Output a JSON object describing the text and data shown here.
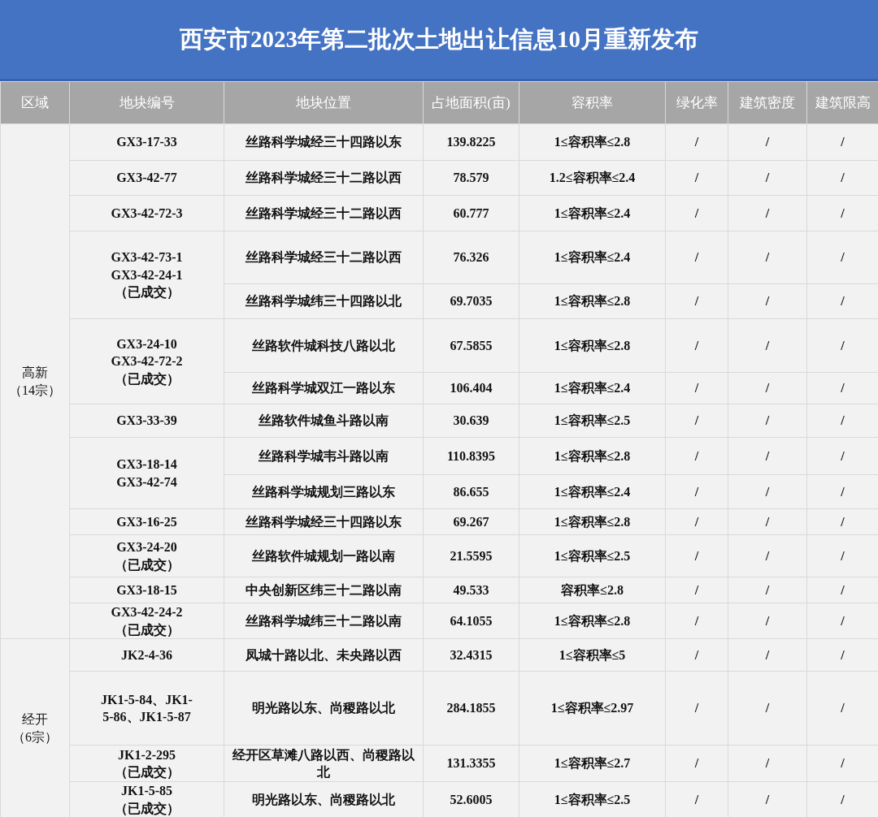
{
  "title": "西安市2023年第二批次土地出让信息10月重新发布",
  "table": {
    "columns": [
      "区域",
      "地块编号",
      "地块位置",
      "占地面积(亩)",
      "容积率",
      "绿化率",
      "建筑密度",
      "建筑限高"
    ],
    "regions": [
      {
        "name": "高新",
        "count": "（14宗）",
        "groups": [
          {
            "code": "GX3-17-33",
            "plots": [
              {
                "location": "丝路科学城经三十四路以东",
                "area": "139.8225",
                "far": "1≤容积率≤2.8",
                "green": "/",
                "density": "/",
                "height": "/"
              }
            ]
          },
          {
            "code": "GX3-42-77",
            "plots": [
              {
                "location": "丝路科学城经三十二路以西",
                "area": "78.579",
                "far": "1.2≤容积率≤2.4",
                "green": "/",
                "density": "/",
                "height": "/"
              }
            ]
          },
          {
            "code": "GX3-42-72-3",
            "plots": [
              {
                "location": "丝路科学城经三十二路以西",
                "area": "60.777",
                "far": "1≤容积率≤2.4",
                "green": "/",
                "density": "/",
                "height": "/"
              }
            ]
          },
          {
            "code": "GX3-42-73-1\nGX3-42-24-1\n（已成交）",
            "plots": [
              {
                "location": "丝路科学城经三十二路以西",
                "area": "76.326",
                "far": "1≤容积率≤2.4",
                "green": "/",
                "density": "/",
                "height": "/"
              },
              {
                "location": "丝路科学城纬三十四路以北",
                "area": "69.7035",
                "far": "1≤容积率≤2.8",
                "green": "/",
                "density": "/",
                "height": "/"
              }
            ]
          },
          {
            "code": "GX3-24-10\nGX3-42-72-2\n（已成交）",
            "plots": [
              {
                "location": "丝路软件城科技八路以北",
                "area": "67.5855",
                "far": "1≤容积率≤2.8",
                "green": "/",
                "density": "/",
                "height": "/"
              },
              {
                "location": "丝路科学城双江一路以东",
                "area": "106.404",
                "far": "1≤容积率≤2.4",
                "green": "/",
                "density": "/",
                "height": "/"
              }
            ]
          },
          {
            "code": "GX3-33-39",
            "plots": [
              {
                "location": "丝路软件城鱼斗路以南",
                "area": "30.639",
                "far": "1≤容积率≤2.5",
                "green": "/",
                "density": "/",
                "height": "/"
              }
            ]
          },
          {
            "code": "GX3-18-14\nGX3-42-74",
            "plots": [
              {
                "location": "丝路科学城韦斗路以南",
                "area": "110.8395",
                "far": "1≤容积率≤2.8",
                "green": "/",
                "density": "/",
                "height": "/"
              },
              {
                "location": "丝路科学城规划三路以东",
                "area": "86.655",
                "far": "1≤容积率≤2.4",
                "green": "/",
                "density": "/",
                "height": "/"
              }
            ]
          },
          {
            "code": "GX3-16-25",
            "plots": [
              {
                "location": "丝路科学城经三十四路以东",
                "area": "69.267",
                "far": "1≤容积率≤2.8",
                "green": "/",
                "density": "/",
                "height": "/"
              }
            ]
          },
          {
            "code": "GX3-24-20\n（已成交）",
            "plots": [
              {
                "location": "丝路软件城规划一路以南",
                "area": "21.5595",
                "far": "1≤容积率≤2.5",
                "green": "/",
                "density": "/",
                "height": "/"
              }
            ]
          },
          {
            "code": "GX3-18-15",
            "plots": [
              {
                "location": "中央创新区纬三十二路以南",
                "area": "49.533",
                "far": "容积率≤2.8",
                "green": "/",
                "density": "/",
                "height": "/"
              }
            ]
          },
          {
            "code": "GX3-42-24-2\n（已成交）",
            "plots": [
              {
                "location": "丝路科学城纬三十二路以南",
                "area": "64.1055",
                "far": "1≤容积率≤2.8",
                "green": "/",
                "density": "/",
                "height": "/"
              }
            ]
          }
        ]
      },
      {
        "name": "经开",
        "count": "（6宗）",
        "groups": [
          {
            "code": "JK2-4-36",
            "plots": [
              {
                "location": "凤城十路以北、未央路以西",
                "area": "32.4315",
                "far": "1≤容积率≤5",
                "green": "/",
                "density": "/",
                "height": "/"
              }
            ]
          },
          {
            "code": "JK1-5-84、JK1-\n5-86、JK1-5-87",
            "plots": [
              {
                "location": "明光路以东、尚稷路以北",
                "area": "284.1855",
                "far": "1≤容积率≤2.97",
                "green": "/",
                "density": "/",
                "height": "/"
              }
            ]
          },
          {
            "code": "JK1-2-295\n（已成交）",
            "plots": [
              {
                "location": "经开区草滩八路以西、尚稷路以北",
                "area": "131.3355",
                "far": "1≤容积率≤2.7",
                "green": "/",
                "density": "/",
                "height": "/"
              }
            ]
          },
          {
            "code": "JK1-5-85\n（已成交）",
            "plots": [
              {
                "location": "明光路以东、尚稷路以北",
                "area": "52.6005",
                "far": "1≤容积率≤2.5",
                "green": "/",
                "density": "/",
                "height": "/"
              }
            ]
          }
        ]
      }
    ]
  }
}
